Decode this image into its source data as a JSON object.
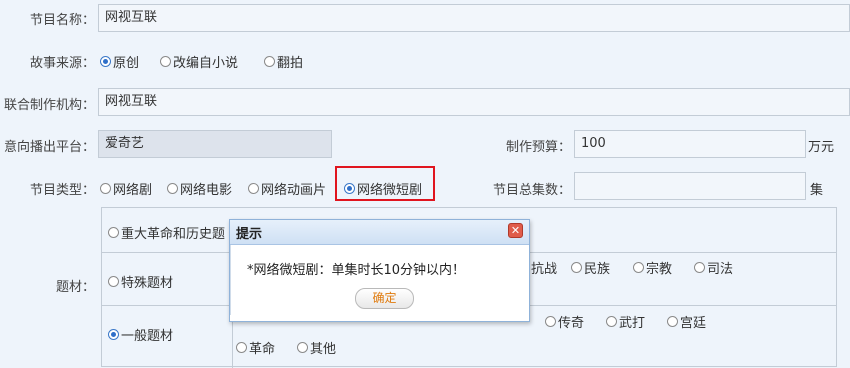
{
  "form": {
    "program_name": {
      "label": "节目名称：",
      "value": "网视互联"
    },
    "story_source": {
      "label": "故事来源：",
      "options": [
        "原创",
        "改编自小说",
        "翻拍"
      ],
      "selected": "原创"
    },
    "co_producer": {
      "label": "联合制作机构：",
      "value": "网视互联"
    },
    "platform": {
      "label": "意向播出平台：",
      "value": "爱奇艺"
    },
    "budget": {
      "label": "制作预算：",
      "value": "100",
      "unit": "万元"
    },
    "program_type": {
      "label": "节目类型：",
      "options": [
        "网络剧",
        "网络电影",
        "网络动画片",
        "网络微短剧"
      ],
      "selected": "网络微短剧"
    },
    "episodes": {
      "label": "节目总集数：",
      "value": "",
      "unit": "集"
    },
    "theme": {
      "label": "题材：",
      "categories": [
        {
          "label": "重大革命和历史题",
          "selected": false
        },
        {
          "label": "特殊题材",
          "selected": false
        },
        {
          "label": "一般题材",
          "selected": true
        }
      ],
      "special_options": [
        "抗战",
        "民族",
        "宗教",
        "司法"
      ],
      "general_options_row1": [
        "传奇",
        "武打",
        "宫廷"
      ],
      "general_options_row2": [
        "革命",
        "其他"
      ]
    }
  },
  "dialog": {
    "title": "提示",
    "message": "*网络微短剧：单集时长10分钟以内！",
    "ok_label": "确定"
  },
  "colors": {
    "highlight_border": "#e0141e",
    "radio_selected": "#2f6fc9",
    "ok_text": "#e07b0e"
  }
}
